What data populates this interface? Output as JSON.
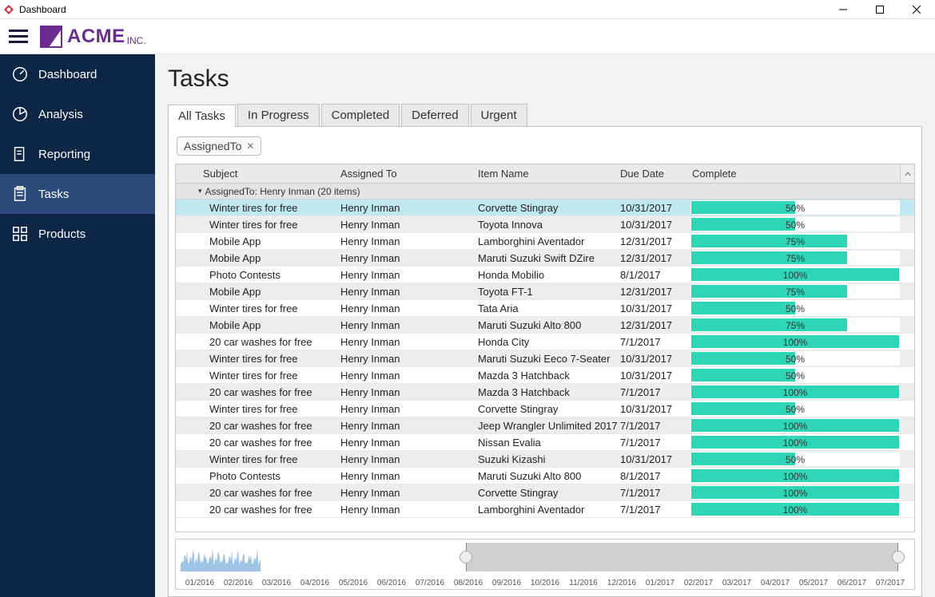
{
  "window": {
    "title": "Dashboard"
  },
  "brand": {
    "name": "ACME",
    "suffix": "INC."
  },
  "sidebar": {
    "items": [
      {
        "key": "dashboard",
        "label": "Dashboard"
      },
      {
        "key": "analysis",
        "label": "Analysis"
      },
      {
        "key": "reporting",
        "label": "Reporting"
      },
      {
        "key": "tasks",
        "label": "Tasks"
      },
      {
        "key": "products",
        "label": "Products"
      }
    ],
    "active": "tasks"
  },
  "page": {
    "title": "Tasks"
  },
  "tabs": {
    "items": [
      "All Tasks",
      "In Progress",
      "Completed",
      "Deferred",
      "Urgent"
    ],
    "active": 0
  },
  "filter_chip": {
    "label": "AssignedTo"
  },
  "grid": {
    "columns": [
      "Subject",
      "Assigned To",
      "Item Name",
      "Due Date",
      "Complete"
    ],
    "group": {
      "field": "AssignedTo",
      "value": "Henry Inman",
      "count": 20,
      "label": "AssignedTo: Henry Inman (20 items)"
    },
    "rows": [
      {
        "subject": "Winter tires for free",
        "assigned": "Henry Inman",
        "item": "Corvette Stingray",
        "due": "10/31/2017",
        "complete": 50,
        "selected": true
      },
      {
        "subject": "Winter tires for free",
        "assigned": "Henry Inman",
        "item": "Toyota Innova",
        "due": "10/31/2017",
        "complete": 50
      },
      {
        "subject": "Mobile App",
        "assigned": "Henry Inman",
        "item": "Lamborghini Aventador",
        "due": "12/31/2017",
        "complete": 75
      },
      {
        "subject": "Mobile App",
        "assigned": "Henry Inman",
        "item": "Maruti Suzuki Swift DZire",
        "due": "12/31/2017",
        "complete": 75
      },
      {
        "subject": "Photo Contests",
        "assigned": "Henry Inman",
        "item": "Honda Mobilio",
        "due": "8/1/2017",
        "complete": 100
      },
      {
        "subject": "Mobile App",
        "assigned": "Henry Inman",
        "item": "Toyota FT-1",
        "due": "12/31/2017",
        "complete": 75
      },
      {
        "subject": "Winter tires for free",
        "assigned": "Henry Inman",
        "item": "Tata Aria",
        "due": "10/31/2017",
        "complete": 50
      },
      {
        "subject": "Mobile App",
        "assigned": "Henry Inman",
        "item": "Maruti Suzuki Alto 800",
        "due": "12/31/2017",
        "complete": 75
      },
      {
        "subject": "20 car washes for free",
        "assigned": "Henry Inman",
        "item": "Honda City",
        "due": "7/1/2017",
        "complete": 100
      },
      {
        "subject": "Winter tires for free",
        "assigned": "Henry Inman",
        "item": "Maruti Suzuki Eeco 7-Seater",
        "due": "10/31/2017",
        "complete": 50
      },
      {
        "subject": "Winter tires for free",
        "assigned": "Henry Inman",
        "item": "Mazda 3 Hatchback",
        "due": "10/31/2017",
        "complete": 50
      },
      {
        "subject": "20 car washes for free",
        "assigned": "Henry Inman",
        "item": "Mazda 3 Hatchback",
        "due": "7/1/2017",
        "complete": 100
      },
      {
        "subject": "Winter tires for free",
        "assigned": "Henry Inman",
        "item": "Corvette Stingray",
        "due": "10/31/2017",
        "complete": 50
      },
      {
        "subject": "20 car washes for free",
        "assigned": "Henry Inman",
        "item": "Jeep Wrangler Unlimited 2017",
        "due": "7/1/2017",
        "complete": 100
      },
      {
        "subject": "20 car washes for free",
        "assigned": "Henry Inman",
        "item": "Nissan Evalia",
        "due": "7/1/2017",
        "complete": 100
      },
      {
        "subject": "Winter tires for free",
        "assigned": "Henry Inman",
        "item": "Suzuki Kizashi",
        "due": "10/31/2017",
        "complete": 50
      },
      {
        "subject": "Photo Contests",
        "assigned": "Henry Inman",
        "item": "Maruti Suzuki Alto 800",
        "due": "8/1/2017",
        "complete": 100
      },
      {
        "subject": "20 car washes for free",
        "assigned": "Henry Inman",
        "item": "Corvette Stingray",
        "due": "7/1/2017",
        "complete": 100
      },
      {
        "subject": "20 car washes for free",
        "assigned": "Henry Inman",
        "item": "Lamborghini Aventador",
        "due": "7/1/2017",
        "complete": 100
      }
    ]
  },
  "timeline": {
    "labels": [
      "01/2016",
      "02/2016",
      "03/2016",
      "04/2016",
      "05/2016",
      "06/2016",
      "07/2016",
      "08/2016",
      "09/2016",
      "10/2016",
      "11/2016",
      "12/2016",
      "01/2017",
      "02/2017",
      "03/2017",
      "04/2017",
      "05/2017",
      "06/2017",
      "07/2017"
    ],
    "selection": {
      "start_pct": 39,
      "end_pct": 98
    }
  }
}
